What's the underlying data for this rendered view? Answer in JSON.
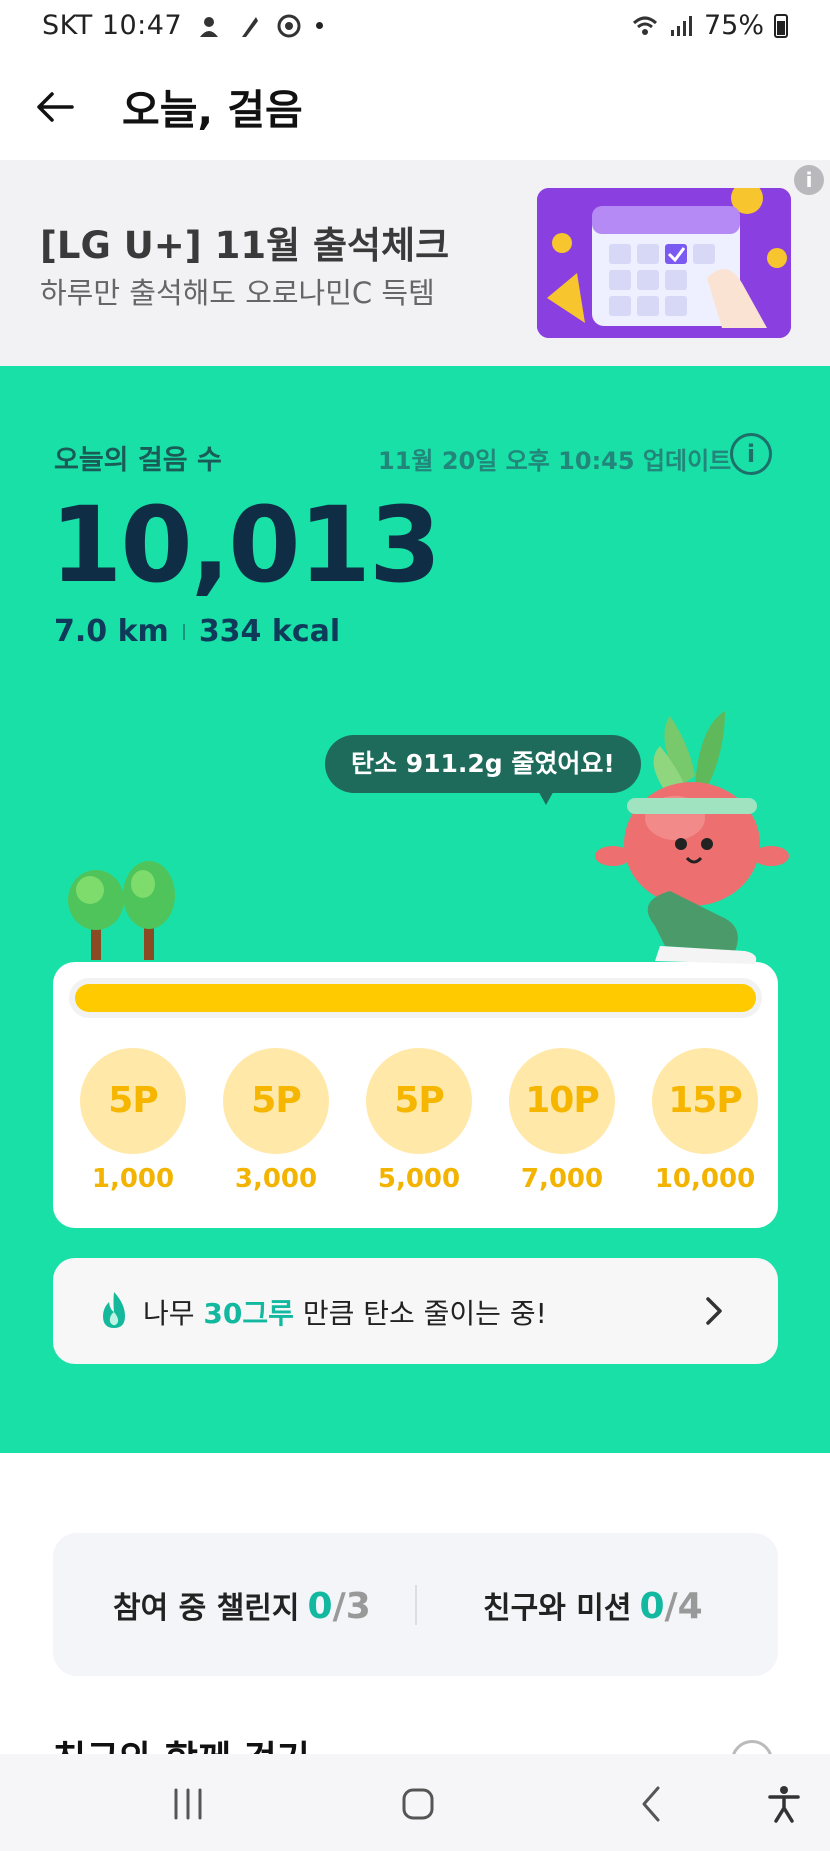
{
  "status_bar": {
    "carrier_time": "SKT 10:47",
    "battery": "75%"
  },
  "header": {
    "title": "오늘, 걸음"
  },
  "banner": {
    "title": "[LG U+] 11월 출석체크",
    "subtitle": "하루만 출석해도 오로나민C 득템"
  },
  "steps": {
    "label": "오늘의 걸음 수",
    "updated": "11월 20일 오후 10:45 업데이트",
    "count": "10,013",
    "distance": "7.0 km",
    "calories": "334 kcal",
    "progress": 1.0
  },
  "carbon_bubble": "탄소 911.2g 줄였어요!",
  "milestones": [
    {
      "points": "5P",
      "steps": "1,000"
    },
    {
      "points": "5P",
      "steps": "3,000"
    },
    {
      "points": "5P",
      "steps": "5,000"
    },
    {
      "points": "10P",
      "steps": "7,000"
    },
    {
      "points": "15P",
      "steps": "10,000"
    }
  ],
  "carbon_card": {
    "prefix": "나무 ",
    "highlight": "30그루",
    "suffix": " 만큼 탄소 줄이는 중!"
  },
  "challenges": {
    "participating_label": "참여 중 챌린지",
    "participating_current": "0",
    "participating_total": "/3",
    "friends_label": "친구와 미션",
    "friends_current": "0",
    "friends_total": "/4"
  },
  "section_title": "친구와 함께 걷기",
  "colors": {
    "green_bg": "#19e0a7",
    "progress_fill": "#ffcb00",
    "milestone_circle": "#ffe8a8",
    "accent_teal": "#12b8a0"
  }
}
